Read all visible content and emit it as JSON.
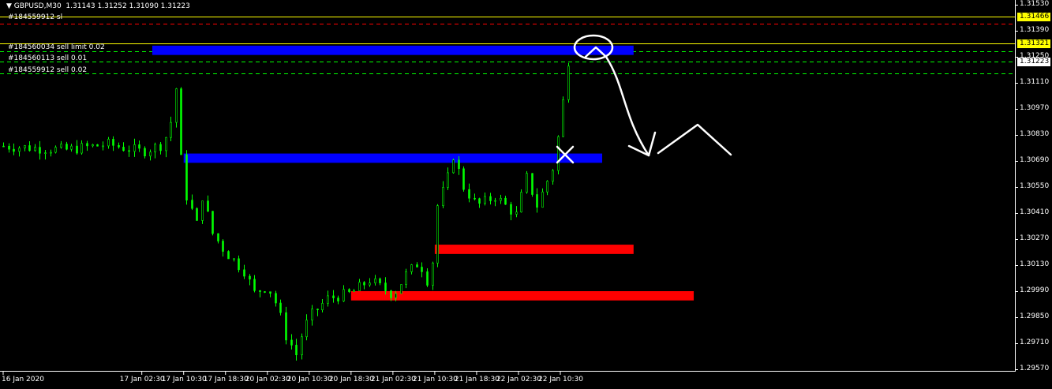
{
  "header": {
    "symbol": "GBPUSD,M30",
    "prices": "1.31143  1.31252  1.31090  1.31223"
  },
  "order_labels": [
    {
      "text": "#184559912 sl"
    },
    {
      "text": "#184560034 sell limit 0.02"
    },
    {
      "text": "#184560113 sell 0.01"
    },
    {
      "text": "#184559912 sell 0.02"
    }
  ],
  "colors": {
    "background": "#000000",
    "candle": "#00ff00",
    "axis": "#ffffff",
    "zone_blue": "#0000ff",
    "zone_red": "#ff0000",
    "tp_line": "#ffff00",
    "sl_line": "#ff0000",
    "order_line": "#00ff00",
    "drawing": "#ffffff"
  },
  "chart_data": {
    "type": "candlestick",
    "title": "GBPUSD,M30",
    "ylim": [
      1.2957,
      1.3153
    ],
    "y_ticks": [
      "1.31530",
      "1.31390",
      "1.31250",
      "1.31110",
      "1.30970",
      "1.30830",
      "1.30690",
      "1.30550",
      "1.30410",
      "1.30270",
      "1.30130",
      "1.29990",
      "1.29850",
      "1.29710",
      "1.29570"
    ],
    "x_ticks": [
      "16 Jan 2020",
      "17 Jan 02:30",
      "17 Jan 10:30",
      "17 Jan 18:30",
      "20 Jan 02:30",
      "20 Jan 10:30",
      "20 Jan 18:30",
      "21 Jan 02:30",
      "21 Jan 10:30",
      "21 Jan 18:30",
      "22 Jan 02:30",
      "22 Jan 10:30"
    ],
    "price_badges": [
      {
        "price": 1.31466,
        "label": "1.31466",
        "color": "#ffff00"
      },
      {
        "price": 1.31321,
        "label": "1.31321",
        "color": "#ffff00"
      },
      {
        "price": 1.31223,
        "label": "1.31223",
        "color": "#ffffff"
      }
    ],
    "horizontal_lines": [
      {
        "price": 1.31466,
        "style": "solid",
        "color": "#ffff00"
      },
      {
        "price": 1.3143,
        "style": "dashed",
        "color": "#ff0000"
      },
      {
        "price": 1.31321,
        "style": "solid",
        "color": "#ffff00"
      },
      {
        "price": 1.3128,
        "style": "dashed",
        "color": "#00ff00"
      },
      {
        "price": 1.31223,
        "style": "dashed",
        "color": "#00ff00"
      },
      {
        "price": 1.3116,
        "style": "dashed",
        "color": "#00ff00"
      }
    ],
    "zones": [
      {
        "color": "#0000ff",
        "price_top": 1.3131,
        "price_bottom": 1.3126,
        "x_start": "17 Jan 04:30",
        "x_end": "23 Jan 00:30"
      },
      {
        "color": "#0000ff",
        "price_top": 1.3073,
        "price_bottom": 1.3068,
        "x_start": "17 Jan 10:30",
        "x_end": "22 Jan 18:30"
      },
      {
        "color": "#ff0000",
        "price_top": 1.3024,
        "price_bottom": 1.3019,
        "x_start": "21 Jan 10:30",
        "x_end": "23 Jan 00:30"
      },
      {
        "color": "#ff0000",
        "price_top": 1.2999,
        "price_bottom": 1.2994,
        "x_start": "20 Jan 18:30",
        "x_end": "23 Jan 12:00"
      }
    ],
    "price_path": [
      [
        "16 Jan 2020",
        1.3077
      ],
      [
        "16 Jan 12:00",
        1.3075
      ],
      [
        "16 Jan 20:00",
        1.3078
      ],
      [
        "17 Jan 02:30",
        1.3074
      ],
      [
        "17 Jan 06:30",
        1.3078
      ],
      [
        "17 Jan 08:00",
        1.309
      ],
      [
        "17 Jan 09:00",
        1.3108
      ],
      [
        "17 Jan 10:00",
        1.307
      ],
      [
        "17 Jan 11:00",
        1.305
      ],
      [
        "17 Jan 13:00",
        1.3035
      ],
      [
        "17 Jan 14:00",
        1.305
      ],
      [
        "17 Jan 16:00",
        1.303
      ],
      [
        "17 Jan 18:30",
        1.302
      ],
      [
        "17 Jan 22:00",
        1.301
      ],
      [
        "20 Jan 00:00",
        1.2998
      ],
      [
        "20 Jan 02:30",
        1.3002
      ],
      [
        "20 Jan 04:30",
        1.299
      ],
      [
        "20 Jan 06:00",
        1.2975
      ],
      [
        "20 Jan 08:00",
        1.2965
      ],
      [
        "20 Jan 09:00",
        1.2975
      ],
      [
        "20 Jan 10:30",
        1.2985
      ],
      [
        "20 Jan 14:00",
        1.2995
      ],
      [
        "20 Jan 18:30",
        1.2998
      ],
      [
        "20 Jan 22:00",
        1.3005
      ],
      [
        "21 Jan 02:30",
        1.2997
      ],
      [
        "21 Jan 05:00",
        1.3008
      ],
      [
        "21 Jan 07:30",
        1.3015
      ],
      [
        "21 Jan 09:00",
        1.3005
      ],
      [
        "21 Jan 10:00",
        1.3015
      ],
      [
        "21 Jan 11:00",
        1.3045
      ],
      [
        "21 Jan 13:00",
        1.306
      ],
      [
        "21 Jan 14:00",
        1.3072
      ],
      [
        "21 Jan 16:00",
        1.3055
      ],
      [
        "21 Jan 18:30",
        1.3045
      ],
      [
        "21 Jan 22:00",
        1.305
      ],
      [
        "22 Jan 02:00",
        1.304
      ],
      [
        "22 Jan 04:00",
        1.306
      ],
      [
        "22 Jan 06:00",
        1.3045
      ],
      [
        "22 Jan 07:30",
        1.3055
      ],
      [
        "22 Jan 09:00",
        1.3065
      ],
      [
        "22 Jan 10:30",
        1.309
      ],
      [
        "22 Jan 12:00",
        1.3123
      ]
    ]
  }
}
